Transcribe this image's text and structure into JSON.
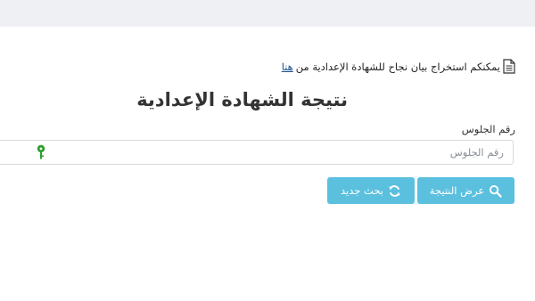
{
  "notice": {
    "text": "يمكنكم استخراج بيان نجاح للشهادة الإعدادية من",
    "link_text": "هنا"
  },
  "page": {
    "title": "نتيجة الشهادة الإعدادية"
  },
  "form": {
    "seat_label": "رقم الجلوس",
    "seat_placeholder": "رقم الجلوس",
    "seat_value": ""
  },
  "buttons": {
    "show_result": "عرض النتيجة",
    "new_search": "بحث جديد"
  },
  "icons": {
    "notice": "document-icon",
    "show_result": "search-icon",
    "new_search": "refresh-icon",
    "input_overlay": "key-icon"
  },
  "colors": {
    "button": "#5bc0de",
    "link": "#1a4f8b",
    "key_icon": "#2e9e2e",
    "top_bar": "#eef0f4"
  }
}
